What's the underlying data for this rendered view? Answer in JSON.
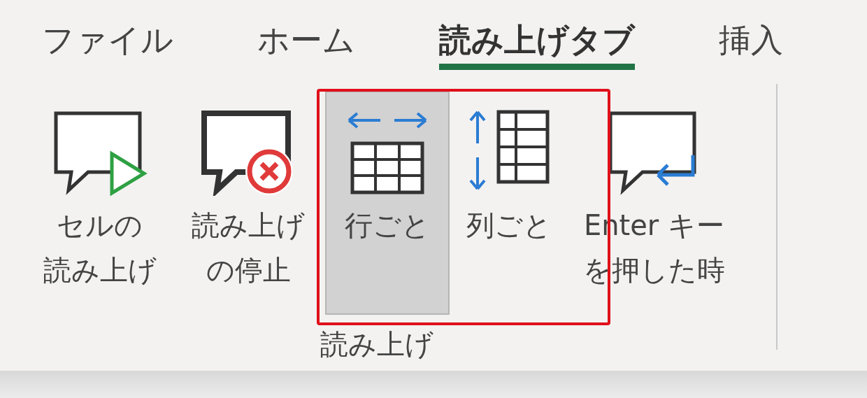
{
  "tabs": [
    {
      "label": "ファイル",
      "selected": false
    },
    {
      "label": "ホーム",
      "selected": false
    },
    {
      "label": "読み上げタブ",
      "selected": true
    },
    {
      "label": "挿入",
      "selected": false
    }
  ],
  "ribbon": {
    "buttons": [
      {
        "kind": "read-cell",
        "lines": [
          "セルの",
          "読み上げ"
        ],
        "selected": false
      },
      {
        "kind": "stop",
        "lines": [
          "読み上げ",
          "の停止"
        ],
        "selected": false
      },
      {
        "kind": "by-row",
        "lines": [
          "行ごと"
        ],
        "selected": true
      },
      {
        "kind": "by-column",
        "lines": [
          "列ごと"
        ],
        "selected": false
      },
      {
        "kind": "on-enter",
        "lines": [
          "Enter キー",
          "を押した時"
        ],
        "selected": false
      }
    ],
    "group_label": "読み上げ"
  }
}
